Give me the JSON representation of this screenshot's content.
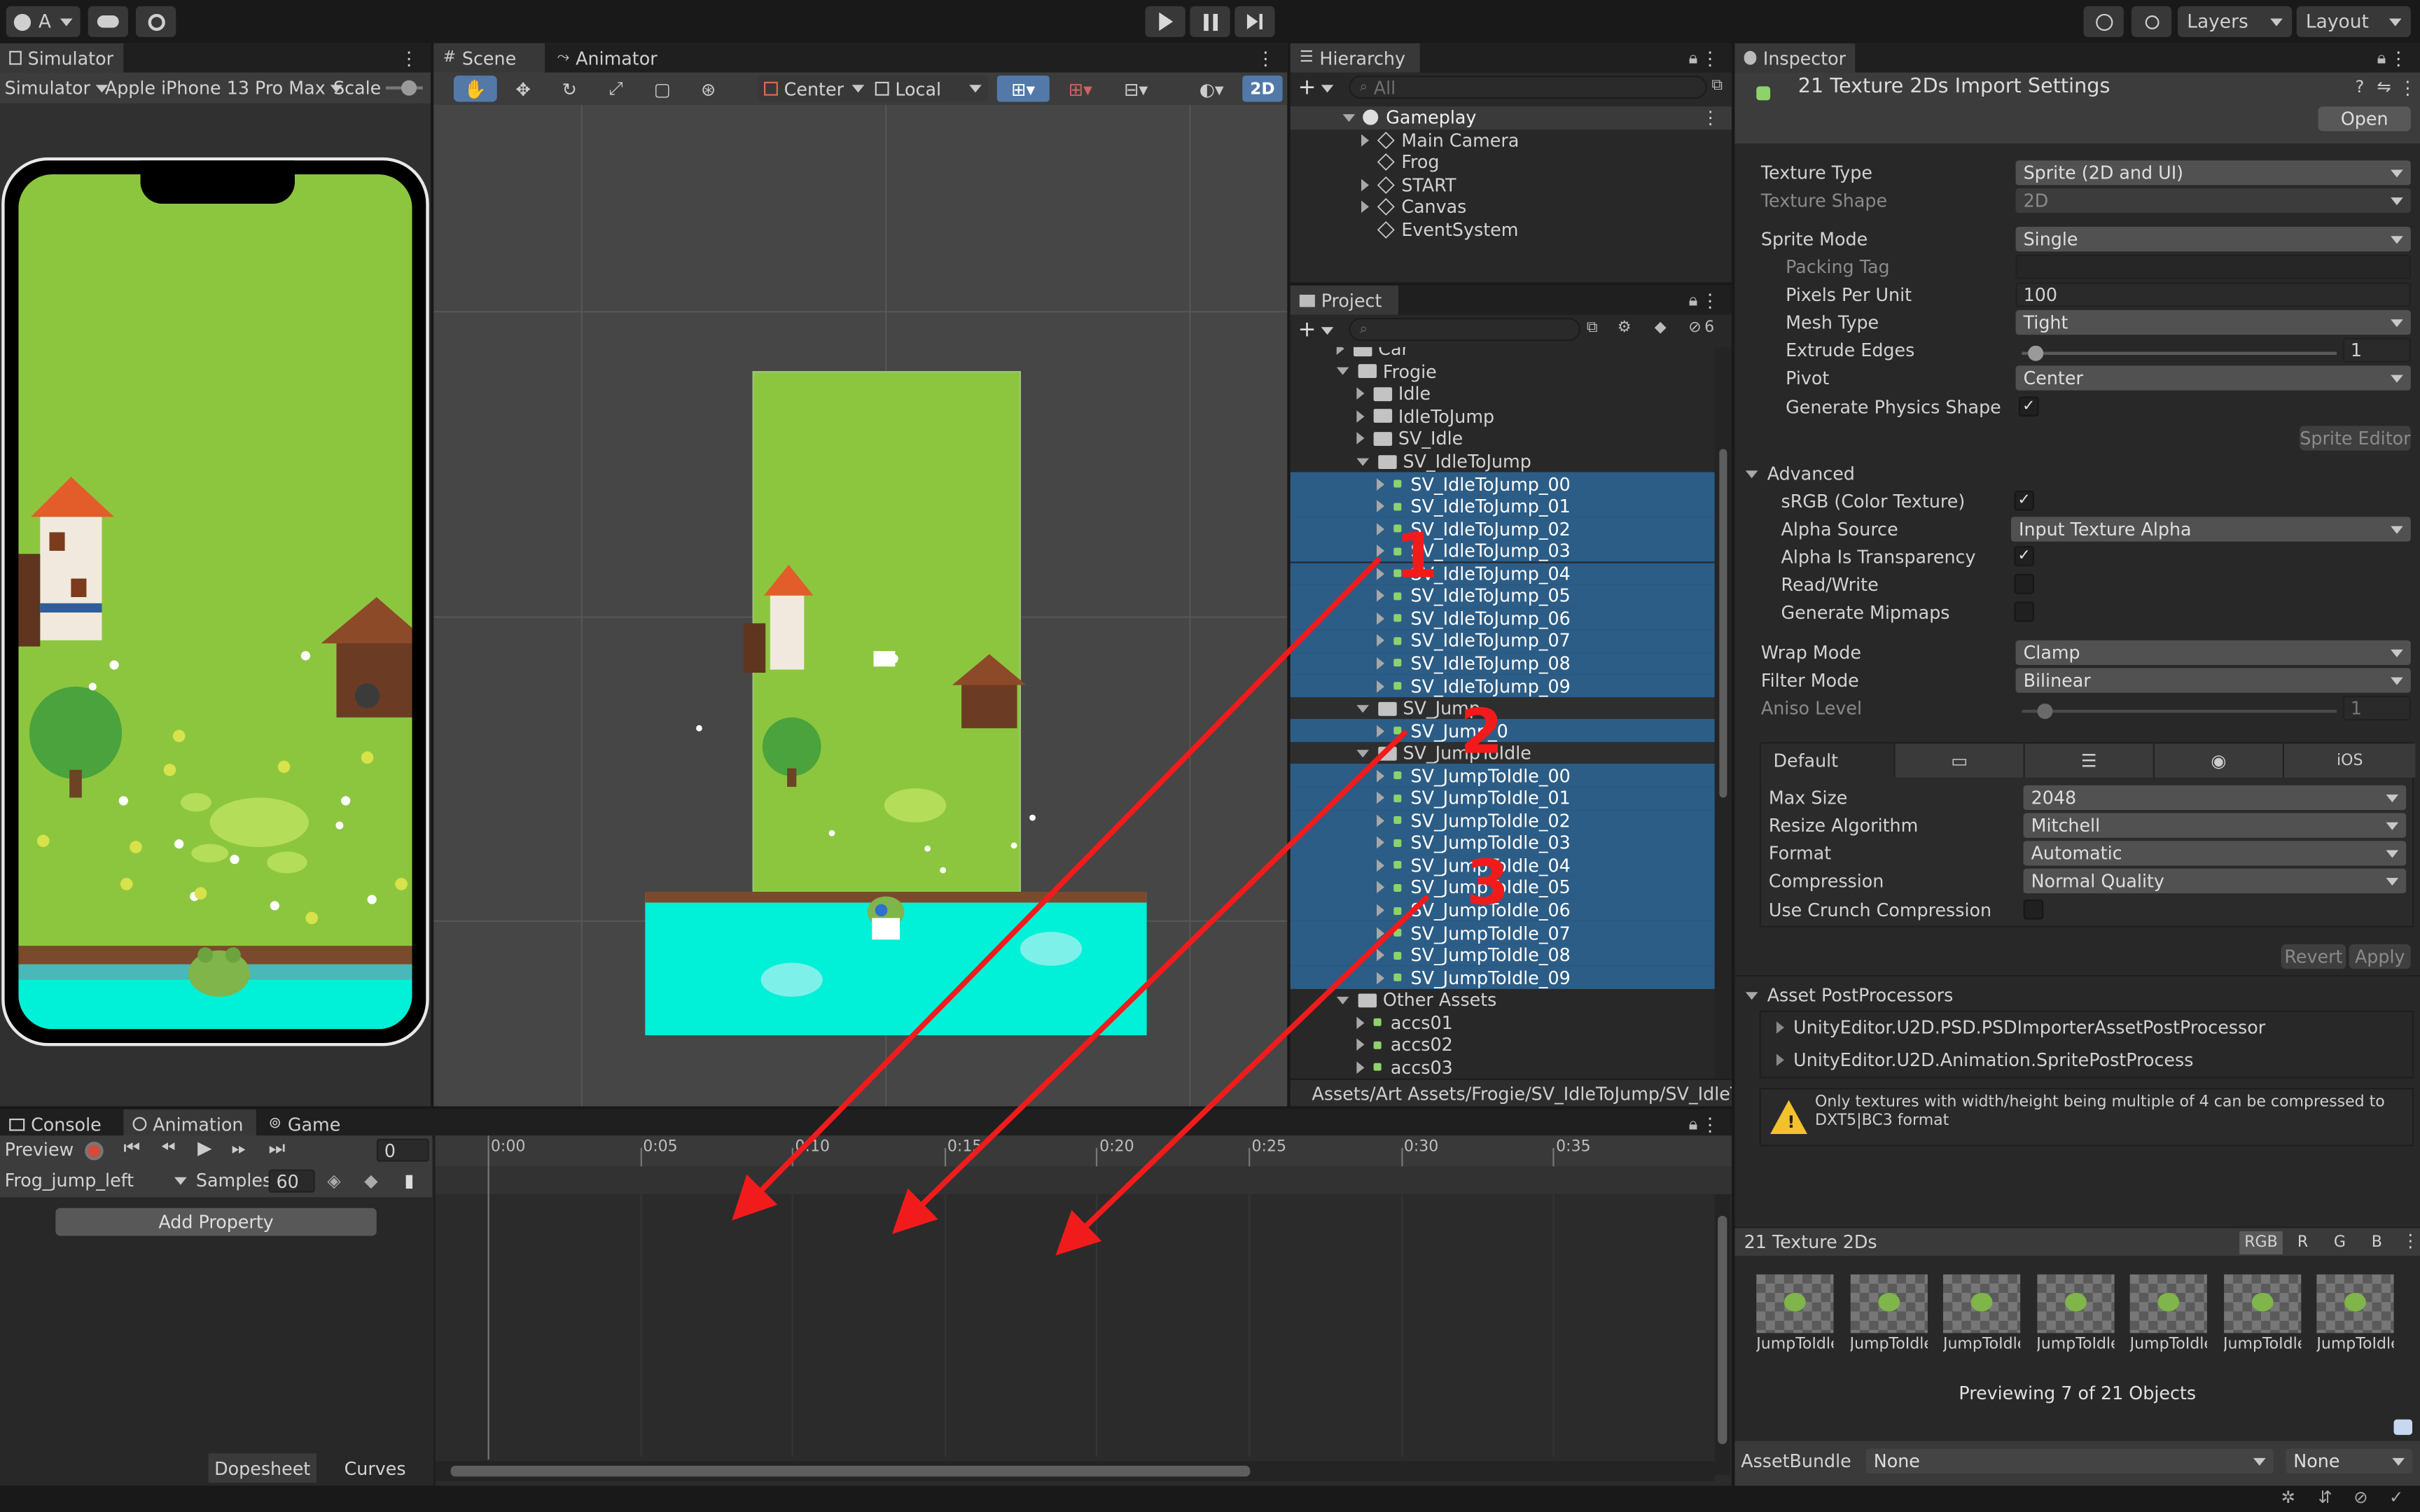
{
  "topbar": {
    "account": "A",
    "layers": "Layers",
    "layout": "Layout"
  },
  "simulator": {
    "tab": "Simulator",
    "mode": "Simulator",
    "device": "Apple iPhone 13 Pro Max",
    "scale_label": "Scale"
  },
  "scene": {
    "tab_scene": "Scene",
    "tab_animator": "Animator",
    "pivot": "Center",
    "space": "Local",
    "mode_2d": "2D"
  },
  "hierarchy": {
    "tab": "Hierarchy",
    "search_placeholder": "All",
    "root": "Gameplay",
    "items": [
      "Main Camera",
      "Frog",
      "START",
      "Canvas",
      "EventSystem"
    ]
  },
  "project": {
    "tab": "Project",
    "hidden_count": "6",
    "folders_top": [
      "Car",
      "Frogie"
    ],
    "frogie_children": [
      "Idle",
      "IdleToJump",
      "SV_Idle",
      "SV_IdleToJump"
    ],
    "idle_to_jump_sprites": [
      "SV_IdleToJump_00",
      "SV_IdleToJump_01",
      "SV_IdleToJump_02",
      "SV_IdleToJump_03",
      "SV_IdleToJump_04",
      "SV_IdleToJump_05",
      "SV_IdleToJump_06",
      "SV_IdleToJump_07",
      "SV_IdleToJump_08",
      "SV_IdleToJump_09"
    ],
    "sv_jump": "SV_Jump",
    "sv_jump_sprite": "SV_Jump_0",
    "sv_jump_to_idle": "SV_JumpToIdle",
    "jump_to_idle_sprites": [
      "SV_JumpToIdle_00",
      "SV_JumpToIdle_01",
      "SV_JumpToIdle_02",
      "SV_JumpToIdle_03",
      "SV_JumpToIdle_04",
      "SV_JumpToIdle_05",
      "SV_JumpToIdle_06",
      "SV_JumpToIdle_07",
      "SV_JumpToIdle_08",
      "SV_JumpToIdle_09"
    ],
    "other_assets": "Other Assets",
    "other_items": [
      "accs01",
      "accs02",
      "accs03"
    ],
    "path": "Assets/Art Assets/Frogie/SV_IdleToJump/SV_IdleTo..."
  },
  "annotations": [
    "1",
    "2",
    "3"
  ],
  "inspector": {
    "tab": "Inspector",
    "title": "21 Texture 2Ds Import Settings",
    "open_button": "Open",
    "texture_type_label": "Texture Type",
    "texture_type": "Sprite (2D and UI)",
    "texture_shape_label": "Texture Shape",
    "texture_shape": "2D",
    "sprite_mode_label": "Sprite Mode",
    "sprite_mode": "Single",
    "packing_tag_label": "Packing Tag",
    "ppu_label": "Pixels Per Unit",
    "ppu": "100",
    "mesh_type_label": "Mesh Type",
    "mesh_type": "Tight",
    "extrude_label": "Extrude Edges",
    "extrude": "1",
    "pivot_label": "Pivot",
    "pivot": "Center",
    "physics_shape_label": "Generate Physics Shape",
    "physics_shape": true,
    "sprite_editor_button": "Sprite Editor",
    "advanced_label": "Advanced",
    "srgb_label": "sRGB (Color Texture)",
    "srgb": true,
    "alpha_source_label": "Alpha Source",
    "alpha_source": "Input Texture Alpha",
    "alpha_transparency_label": "Alpha Is Transparency",
    "alpha_transparency": true,
    "read_write_label": "Read/Write",
    "read_write": false,
    "mipmaps_label": "Generate Mipmaps",
    "mipmaps": false,
    "wrap_label": "Wrap Mode",
    "wrap": "Clamp",
    "filter_label": "Filter Mode",
    "filter": "Bilinear",
    "aniso_label": "Aniso Level",
    "aniso": "1",
    "platform_default": "Default",
    "platform_ios": "iOS",
    "max_size_label": "Max Size",
    "max_size": "2048",
    "resize_label": "Resize Algorithm",
    "resize": "Mitchell",
    "format_label": "Format",
    "format": "Automatic",
    "compression_label": "Compression",
    "compression": "Normal Quality",
    "crunch_label": "Use Crunch Compression",
    "crunch": false,
    "revert_button": "Revert",
    "apply_button": "Apply",
    "postprocessors_label": "Asset PostProcessors",
    "postprocessors": [
      "UnityEditor.U2D.PSD.PSDImporterAssetPostProcessor",
      "UnityEditor.U2D.Animation.SpritePostProcess"
    ],
    "warning": "Only textures with width/height being multiple of 4 can be compressed to DXT5|BC3 format",
    "preview_title": "21 Texture 2Ds",
    "channels": [
      "RGB",
      "R",
      "G",
      "B"
    ],
    "thumb_label": "JumpToIdle",
    "thumb_count": 7,
    "preview_status": "Previewing 7 of 21 Objects",
    "assetbundle_label": "AssetBundle",
    "assetbundle": "None",
    "assetbundle_variant": "None"
  },
  "animation": {
    "tab_console": "Console",
    "tab_animation": "Animation",
    "tab_game": "Game",
    "preview": "Preview",
    "frame": "0",
    "clip": "Frog_jump_left",
    "samples_label": "Samples",
    "samples": "60",
    "add_property": "Add Property",
    "timeline_ticks": [
      "0:00",
      "0:05",
      "0:10",
      "0:15",
      "0:20",
      "0:25",
      "0:30",
      "0:35"
    ],
    "dopesheet": "Dopesheet",
    "curves": "Curves"
  }
}
